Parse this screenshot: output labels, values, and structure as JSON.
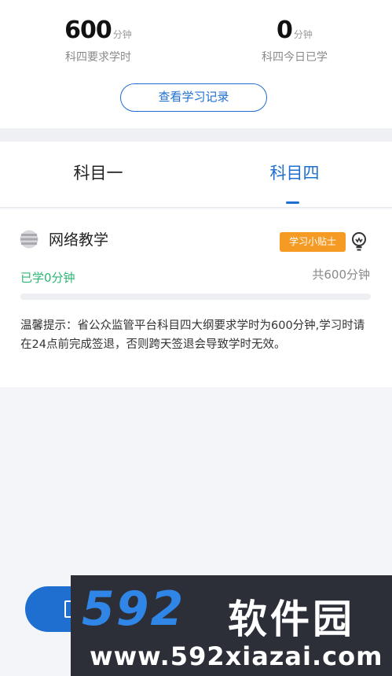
{
  "stats": {
    "required": {
      "value": "600",
      "unit": "分钟",
      "label": "科四要求学时"
    },
    "today": {
      "value": "0",
      "unit": "分钟",
      "label": "科四今日已学"
    }
  },
  "record_button": "查看学习记录",
  "tabs": [
    {
      "label": "科目一",
      "active": false
    },
    {
      "label": "科目四",
      "active": true
    }
  ],
  "course": {
    "icon": "stack-icon",
    "title": "网络教学",
    "tip_badge": "学习小贴士",
    "tip_icon": "bulb-icon",
    "learned": "已学0分钟",
    "total": "共600分钟",
    "progress": 0,
    "notice": "温馨提示：省公众监管平台科目四大纲要求学时为600分钟,学习时请在24点前完成签退，否则跨天签退会导致学时无效。"
  },
  "watermark": {
    "brand_number": "592",
    "brand_text": "软件园",
    "url": "www.592xiazai.com"
  },
  "colors": {
    "accent": "#1e6fd0",
    "success": "#2bb673",
    "badge": "#f59a23"
  }
}
